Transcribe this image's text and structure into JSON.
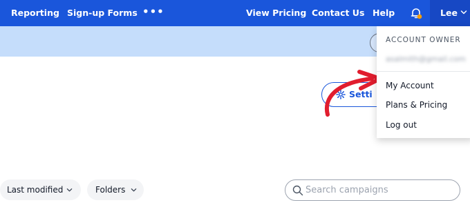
{
  "nav": {
    "items": [
      "Reporting",
      "Sign-up Forms",
      "View Pricing",
      "Contact Us",
      "Help"
    ],
    "more_icon": "more-dots-icon",
    "bell_icon": "bell-icon",
    "user_name": "Lee",
    "user_chevron_icon": "chevron-down-icon",
    "notification_dot_color": "#f59e0b",
    "bar_color": "#1a56db"
  },
  "banner": {
    "color": "#c5ddfb"
  },
  "settings_button": {
    "label": "Setti",
    "icon": "gear-icon"
  },
  "account_menu": {
    "header": "ACCOUNT OWNER",
    "email": "asalmith@gmail.com",
    "items": [
      "My Account",
      "Plans & Pricing",
      "Log out"
    ]
  },
  "annotation": {
    "arrow_color": "#e11d2e"
  },
  "filters": {
    "sort_label": "Last modified",
    "folders_label": "Folders"
  },
  "search": {
    "placeholder": "Search campaigns",
    "value": ""
  }
}
